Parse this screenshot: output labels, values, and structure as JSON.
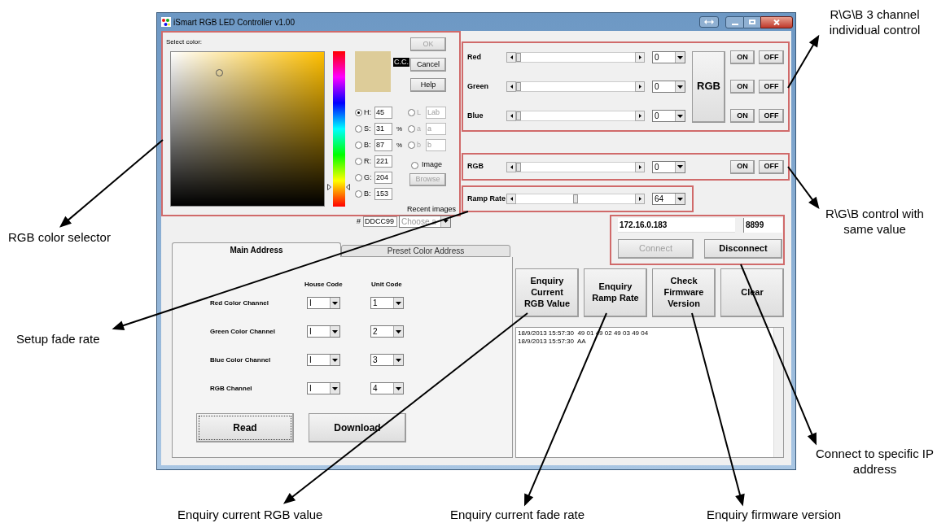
{
  "window": {
    "title": "iSmart RGB LED Controller v1.00"
  },
  "color_picker": {
    "label": "Select color:",
    "badge": "C.C.",
    "buttons": [
      {
        "label": "OK",
        "disabled": true
      },
      {
        "label": "Cancel",
        "disabled": false
      },
      {
        "label": "Help",
        "disabled": false
      }
    ],
    "fields": [
      {
        "label": "H:",
        "value": "45",
        "selected": true
      },
      {
        "label": "S:",
        "value": "31",
        "unit": "%",
        "selected": false
      },
      {
        "label": "B:",
        "value": "87",
        "unit": "%",
        "selected": false
      },
      {
        "label": "R:",
        "value": "221",
        "selected": false
      },
      {
        "label": "G:",
        "value": "204",
        "selected": false
      },
      {
        "label": "B:",
        "value": "153",
        "selected": false
      }
    ],
    "lab_fields": [
      {
        "label": "L",
        "value": "Lab",
        "selected": false,
        "disabled": true
      },
      {
        "label": "a",
        "value": "a",
        "selected": false,
        "disabled": true
      },
      {
        "label": "b",
        "value": "b",
        "selected": false,
        "disabled": true
      }
    ],
    "image_option": {
      "label": "Image",
      "selected": false
    },
    "browse": {
      "label": "Browse",
      "disabled": true
    },
    "recent_label": "Recent images",
    "recent_select": {
      "value": "Choose a",
      "disabled": true
    },
    "hex_label": "#",
    "hex": "DDCC99"
  },
  "channels": [
    {
      "name": "Red",
      "level": 0,
      "value": "0",
      "on": "ON",
      "off": "OFF"
    },
    {
      "name": "Green",
      "level": 0,
      "value": "0",
      "on": "ON",
      "off": "OFF"
    },
    {
      "name": "Blue",
      "level": 0,
      "value": "0",
      "on": "ON",
      "off": "OFF"
    }
  ],
  "rgb_button": "RGB",
  "all_channels": {
    "name": "RGB",
    "level": 0,
    "value": "0",
    "on": "ON",
    "off": "OFF"
  },
  "ramp": {
    "name": "Ramp Rate",
    "level": 0.5,
    "value": "64"
  },
  "connection": {
    "ip": "172.16.0.183",
    "port": "8899",
    "connect": {
      "label": "Connect",
      "disabled": true
    },
    "disconnect": {
      "label": "Disconnect",
      "disabled": false
    }
  },
  "tabs": [
    {
      "label": "Main Address",
      "selected": true
    },
    {
      "label": "Preset Color Address",
      "selected": false
    }
  ],
  "address": {
    "columns": [
      "House Code",
      "Unit Code"
    ],
    "rows": [
      {
        "name": "Red Color Channel",
        "house": "I",
        "unit": "1"
      },
      {
        "name": "Green Color Channel",
        "house": "I",
        "unit": "2"
      },
      {
        "name": "Blue Color Channel",
        "house": "I",
        "unit": "3"
      },
      {
        "name": "RGB Channel",
        "house": "I",
        "unit": "4"
      }
    ],
    "buttons": [
      {
        "label": "Read",
        "focused": true
      },
      {
        "label": "Download",
        "focused": false
      }
    ]
  },
  "actions": [
    "Enquiry Current RGB Value",
    "Enquiry Ramp Rate",
    "Check Firmware Version",
    "Clear"
  ],
  "log": [
    "18/9/2013 15:57:30  49 01 49 02 49 03 49 04",
    "18/9/2013 15:57:30  AA"
  ],
  "annotations": [
    "RGB color selector",
    "Setup fade rate",
    "R\\G\\B 3 channel individual control",
    "R\\G\\B control with same value",
    "Connect to specific IP address",
    "Enquiry current RGB value",
    "Enquiry current fade rate",
    "Enquiry firmware version"
  ]
}
